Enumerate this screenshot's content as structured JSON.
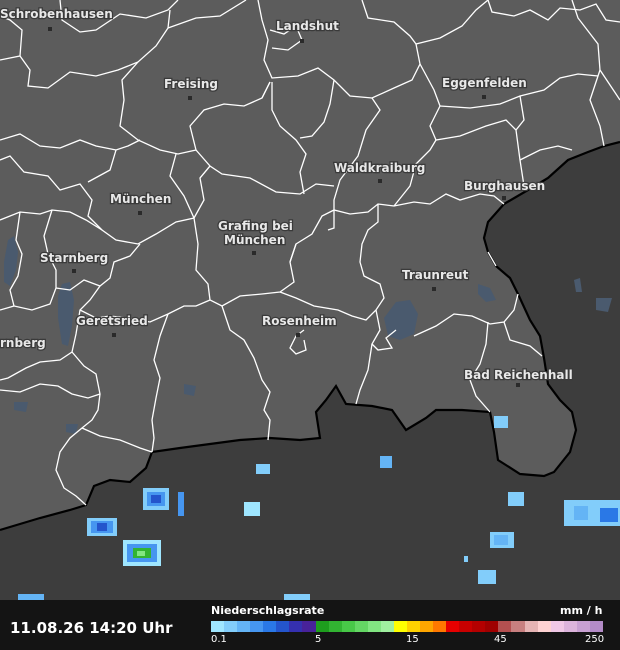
{
  "map": {
    "cities": [
      {
        "name": "Schrobenhausen"
      },
      {
        "name": "Landshut"
      },
      {
        "name": "Freising"
      },
      {
        "name": "Eggenfelden"
      },
      {
        "name": "Waldkraiburg"
      },
      {
        "name": "Burghausen"
      },
      {
        "name": "München"
      },
      {
        "name": "Grafing bei"
      },
      {
        "name": "München"
      },
      {
        "name": "Starnberg"
      },
      {
        "name": "Traunreut"
      },
      {
        "name": "Geretsried"
      },
      {
        "name": "Rosenheim"
      },
      {
        "name": "rnberg"
      },
      {
        "name": "Bad Reichenhall"
      }
    ],
    "colors": {
      "land_germany": "#5c5c5c",
      "land_outside": "#3d3d3d",
      "borders": "#ffffff",
      "national_border": "#000000",
      "water": "#4a5a6e"
    }
  },
  "footer": {
    "timestamp": "11.08.26 14:20 Uhr",
    "legend_title": "Niederschlagsrate",
    "legend_unit": "mm / h",
    "ticks": [
      "0.1",
      "5",
      "15",
      "45",
      "250"
    ],
    "scale_colors": [
      "#9fe6ff",
      "#82cdfa",
      "#64b4f5",
      "#4696f0",
      "#2a78e6",
      "#2455cc",
      "#3530b0",
      "#48229a",
      "#1e9e1e",
      "#32b432",
      "#48c848",
      "#64d764",
      "#82e682",
      "#a0f0a0",
      "#ffff00",
      "#ffd200",
      "#ffa500",
      "#ff7800",
      "#e60000",
      "#c80000",
      "#b40000",
      "#a00000",
      "#b45050",
      "#c88080",
      "#e6b4b4",
      "#ffd2d2",
      "#f0c8e6",
      "#dcb4dc",
      "#c8a0d2",
      "#b48cc8"
    ]
  }
}
